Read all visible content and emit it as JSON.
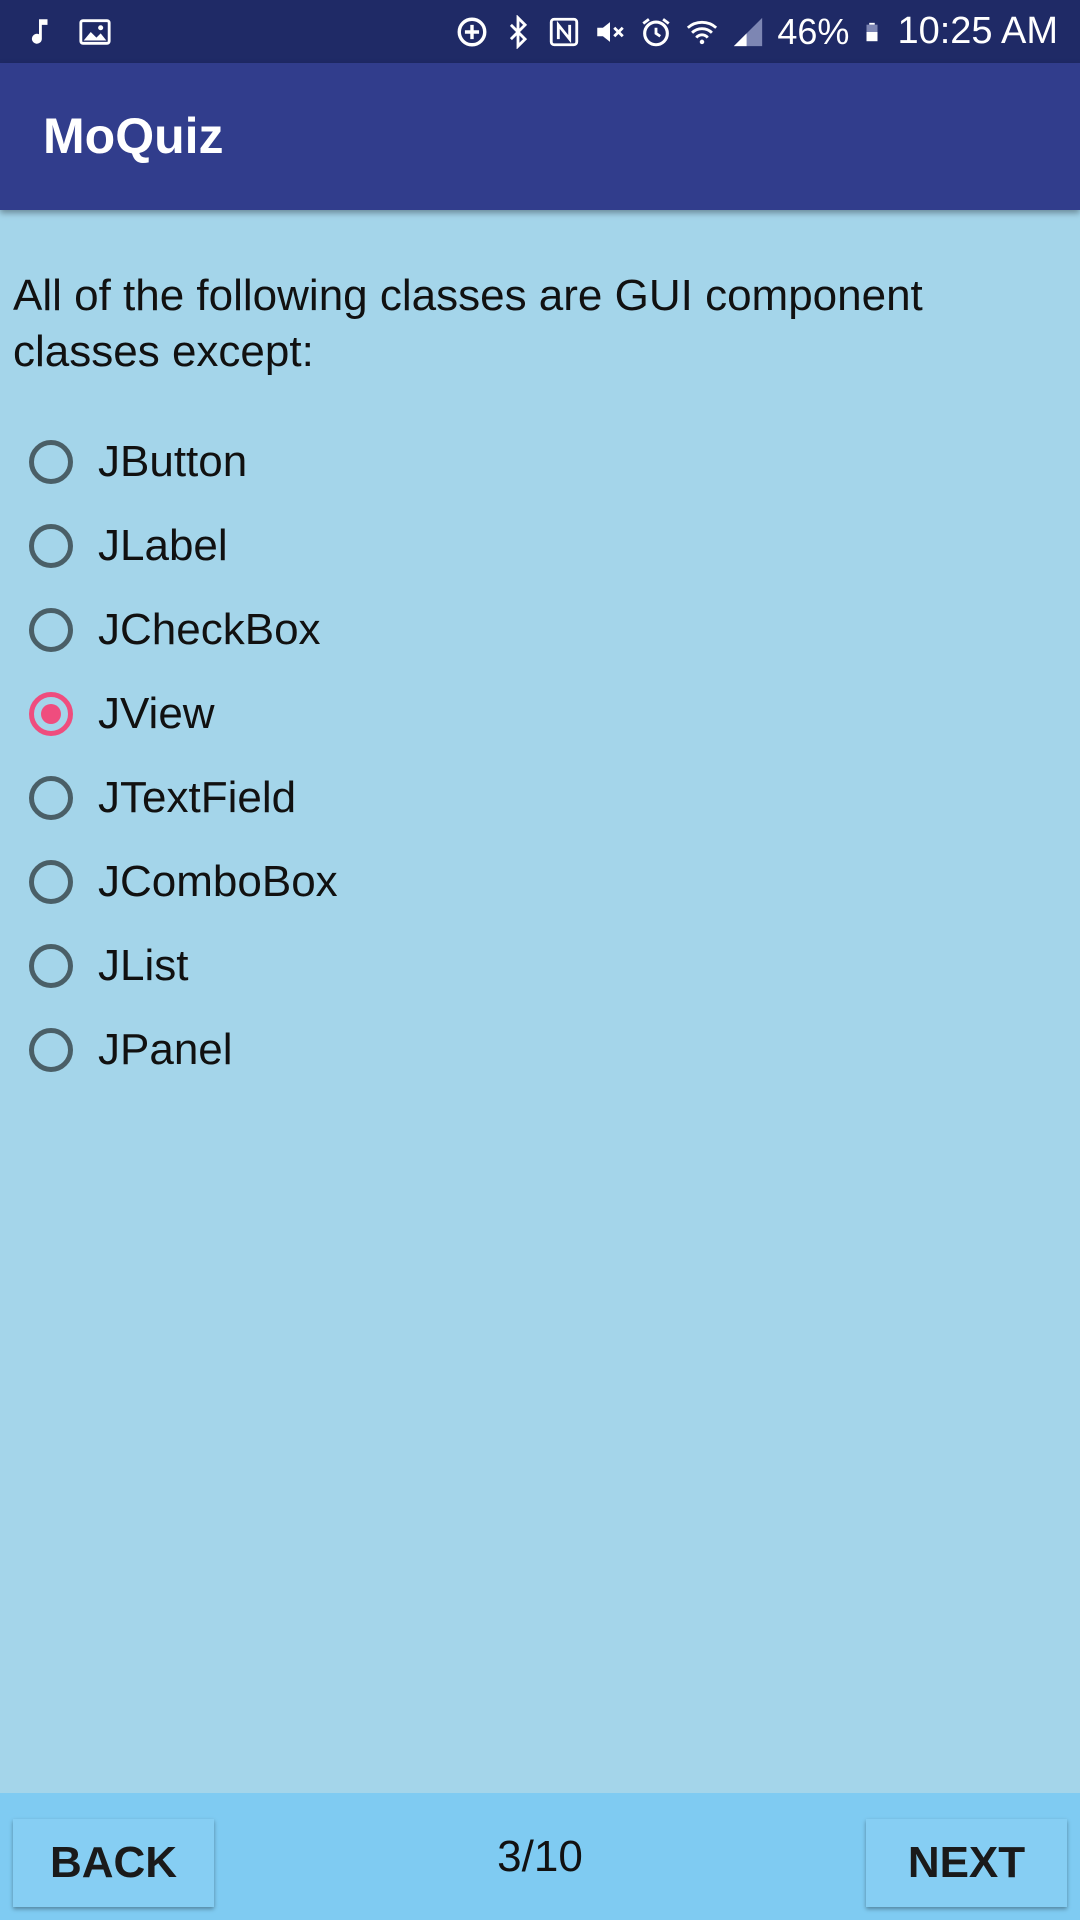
{
  "status_bar": {
    "left_icons": [
      "music-note-icon",
      "image-icon"
    ],
    "right_icons": [
      "data-saver-icon",
      "bluetooth-icon",
      "nfc-icon",
      "mute-icon",
      "alarm-icon",
      "wifi-icon",
      "signal-icon"
    ],
    "battery": "46%",
    "time": "10:25 AM"
  },
  "app_bar": {
    "title": "MoQuiz"
  },
  "question": {
    "text": "All of the following classes are GUI component classes except:",
    "options": [
      {
        "label": "JButton",
        "selected": false
      },
      {
        "label": "JLabel",
        "selected": false
      },
      {
        "label": "JCheckBox",
        "selected": false
      },
      {
        "label": "JView",
        "selected": true
      },
      {
        "label": "JTextField",
        "selected": false
      },
      {
        "label": "JComboBox",
        "selected": false
      },
      {
        "label": "JList",
        "selected": false
      },
      {
        "label": "JPanel",
        "selected": false
      }
    ]
  },
  "bottom_bar": {
    "back_label": "BACK",
    "progress": "3/10",
    "next_label": "NEXT"
  },
  "colors": {
    "status_bar": "#1f2a66",
    "app_bar": "#313d8c",
    "background": "#a4d5ea",
    "bottom_bar": "#7fcbf2",
    "accent": "#ef4d7e",
    "radio_unchecked": "#4a5f67"
  }
}
